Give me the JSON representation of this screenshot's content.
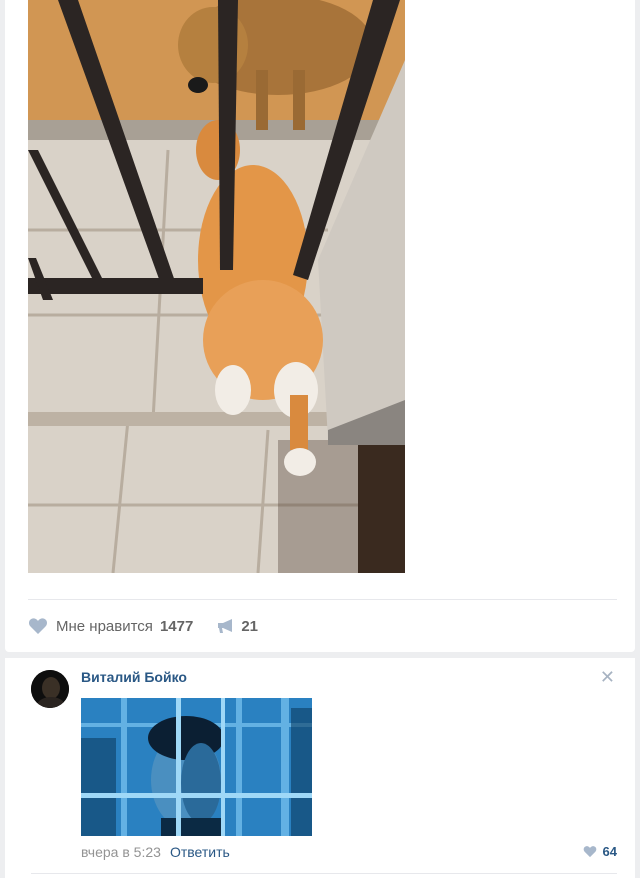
{
  "post": {
    "photo_alt": "photo",
    "likes": {
      "label": "Мне нравится",
      "count": "1477",
      "icon": "heart-icon"
    },
    "shares": {
      "count": "21",
      "icon": "megaphone-icon"
    }
  },
  "comment": {
    "author": "Виталий Бойко",
    "time": "вчера в 5:23",
    "reply_label": "Ответить",
    "likes": "64",
    "close_symbol": "✕"
  },
  "colors": {
    "link": "#2a5885",
    "icon": "#a7b7cb",
    "background": "#edeef0"
  }
}
